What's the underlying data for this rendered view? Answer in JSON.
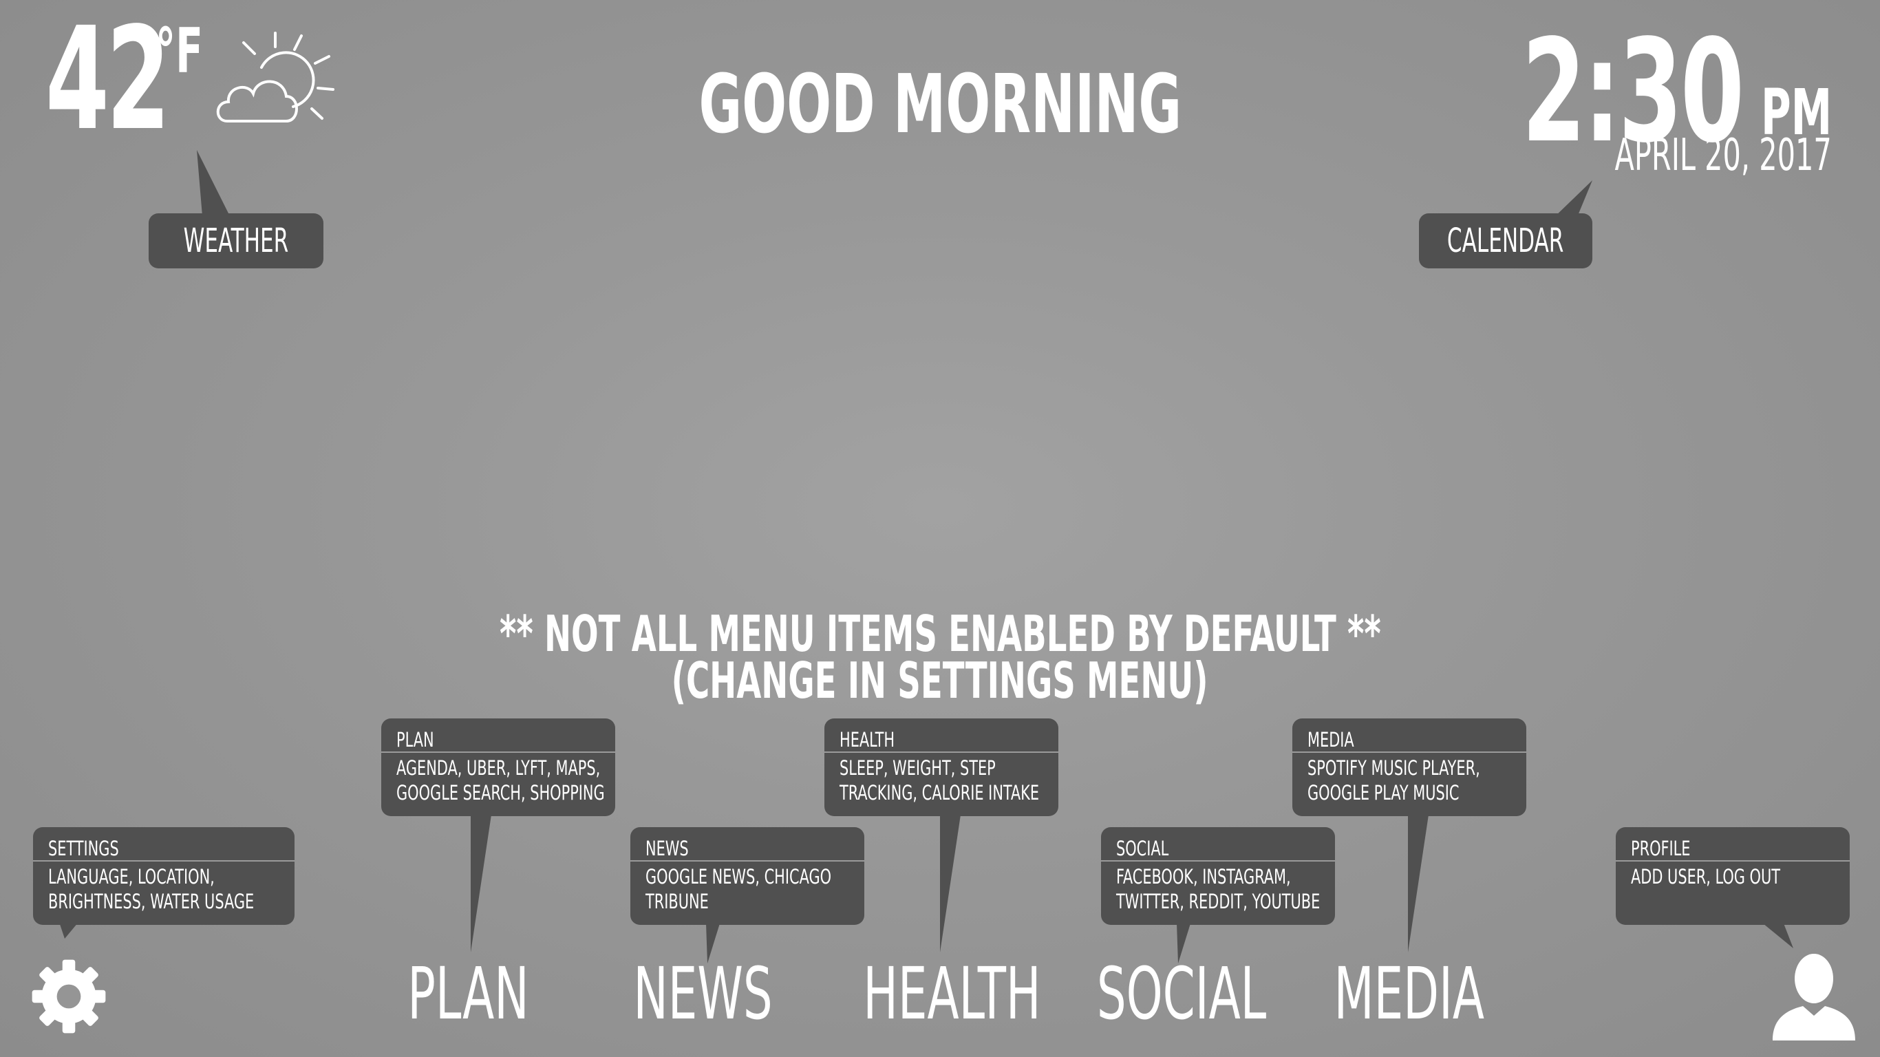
{
  "weather": {
    "temperature": "42",
    "unit": "°F",
    "icon": "partly-cloudy-icon",
    "label": "WEATHER"
  },
  "greeting": "GOOD MORNING",
  "clock": {
    "time": "2:30",
    "ampm": "PM",
    "date": "APRIL 20, 2017",
    "label": "CALENDAR"
  },
  "notice": {
    "line1": "** NOT ALL MENU ITEMS ENABLED BY DEFAULT **",
    "line2": "(CHANGE IN SETTINGS MENU)"
  },
  "menu": {
    "settings": {
      "title": "SETTINGS",
      "desc": "LANGUAGE, LOCATION, BRIGHTNESS, WATER USAGE",
      "icon": "gear-icon"
    },
    "plan": {
      "title": "PLAN",
      "desc": "AGENDA, UBER, LYFT, MAPS, GOOGLE SEARCH, SHOPPING",
      "label": "PLAN"
    },
    "news": {
      "title": "NEWS",
      "desc": "GOOGLE NEWS, CHICAGO TRIBUNE",
      "label": "NEWS"
    },
    "health": {
      "title": "HEALTH",
      "desc": "SLEEP, WEIGHT, STEP TRACKING, CALORIE INTAKE",
      "label": "HEALTH"
    },
    "social": {
      "title": "SOCIAL",
      "desc": "FACEBOOK, INSTAGRAM, TWITTER, REDDIT, YOUTUBE",
      "label": "SOCIAL"
    },
    "media": {
      "title": "MEDIA",
      "desc": "SPOTIFY MUSIC PLAYER, GOOGLE PLAY MUSIC",
      "label": "MEDIA"
    },
    "profile": {
      "title": "PROFILE",
      "desc": "ADD USER, LOG OUT",
      "icon": "user-icon"
    }
  },
  "colors": {
    "background": "#999999",
    "callout": "#505050",
    "text": "#ffffff"
  }
}
